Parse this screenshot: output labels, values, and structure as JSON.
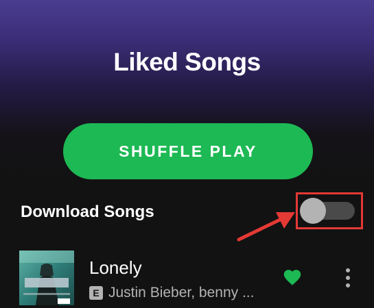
{
  "header": {
    "title": "Liked Songs"
  },
  "actions": {
    "shuffle_label": "SHUFFLE PLAY"
  },
  "download": {
    "label": "Download Songs",
    "enabled": false
  },
  "songs": [
    {
      "title": "Lonely",
      "explicit_badge": "E",
      "artists": "Justin Bieber, benny ...",
      "liked": true,
      "album_art_text": "JUSTICE"
    }
  ],
  "colors": {
    "accent": "#1db954",
    "annotation": "#e53935",
    "background": "#121212",
    "header_gradient_top": "#4a3d8f",
    "secondary_text": "#b3b3b3"
  },
  "icons": {
    "heart": "heart-icon",
    "more": "more-vertical-icon",
    "annotation_arrow": "arrow-icon"
  }
}
